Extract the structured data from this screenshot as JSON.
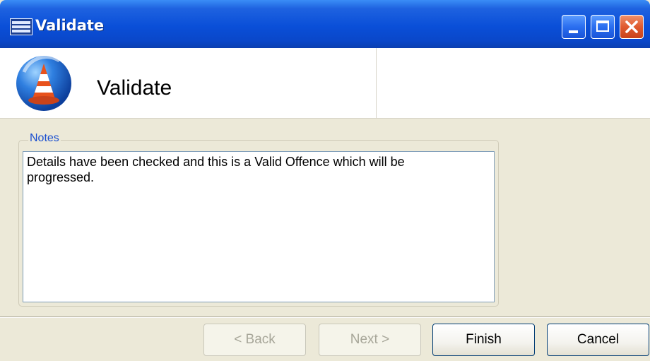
{
  "window": {
    "title": "Validate"
  },
  "header": {
    "title": "Validate",
    "icon": "traffic-cone-icon"
  },
  "notes": {
    "legend": "Notes",
    "text": "Details have been checked and this is a Valid Offence which will be\nprogressed."
  },
  "buttons": {
    "back": "< Back",
    "next": "Next >",
    "finish": "Finish",
    "cancel": "Cancel"
  },
  "colors": {
    "titlebar": "#0a4fd8",
    "legend": "#1a4fd0",
    "cone": "#e8521c"
  }
}
